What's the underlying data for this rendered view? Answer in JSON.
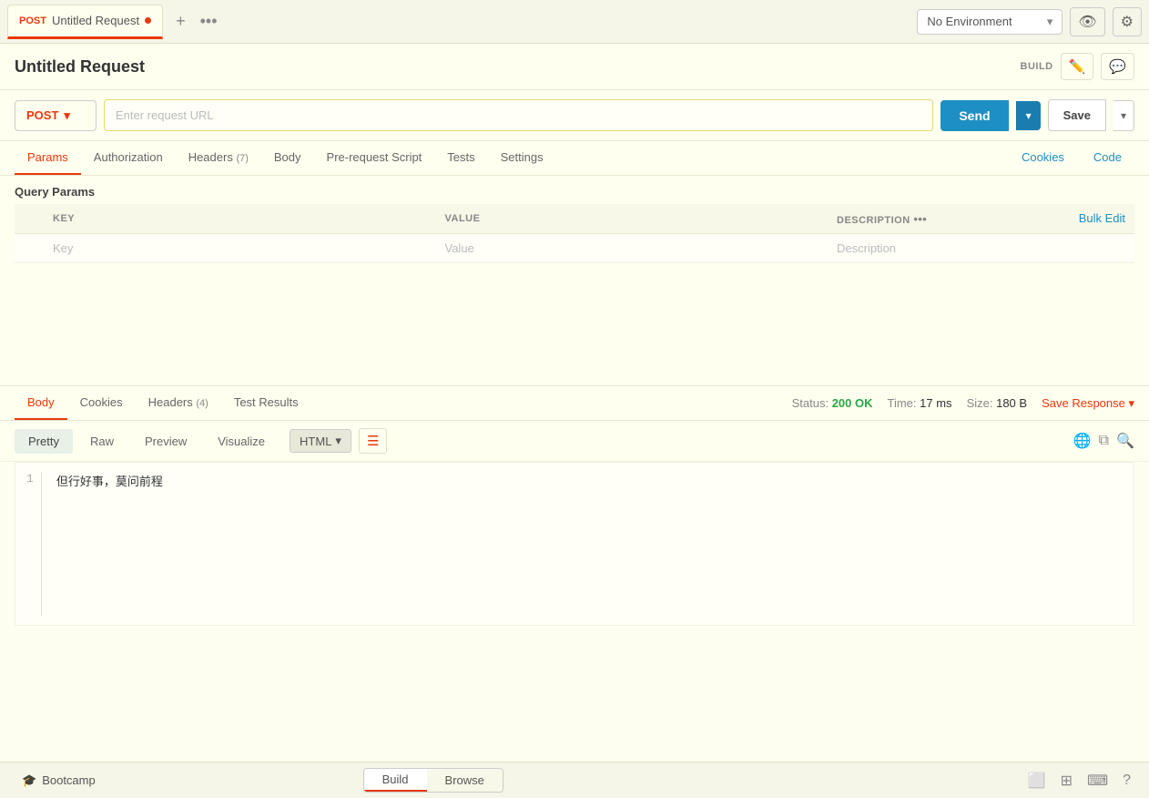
{
  "tab": {
    "method": "POST",
    "name": "Untitled Request",
    "dot": true
  },
  "header": {
    "title": "Untitled Request",
    "build_label": "BUILD"
  },
  "url": {
    "method": "POST",
    "placeholder": "Enter request URL",
    "send_label": "Send",
    "save_label": "Save"
  },
  "request_tabs": [
    {
      "label": "Params",
      "active": true
    },
    {
      "label": "Authorization",
      "active": false
    },
    {
      "label": "Headers (7)",
      "active": false
    },
    {
      "label": "Body",
      "active": false
    },
    {
      "label": "Pre-request Script",
      "active": false
    },
    {
      "label": "Tests",
      "active": false
    },
    {
      "label": "Settings",
      "active": false
    }
  ],
  "request_tab_right": [
    {
      "label": "Cookies"
    },
    {
      "label": "Code"
    }
  ],
  "params": {
    "section_label": "Query Params",
    "columns": [
      {
        "key": "KEY"
      },
      {
        "key": "VALUE"
      },
      {
        "key": "DESCRIPTION"
      }
    ],
    "placeholder_row": {
      "key": "Key",
      "value": "Value",
      "description": "Description"
    },
    "bulk_edit_label": "Bulk Edit"
  },
  "response_tabs": [
    {
      "label": "Body",
      "active": true
    },
    {
      "label": "Cookies",
      "active": false
    },
    {
      "label": "Headers (4)",
      "active": false
    },
    {
      "label": "Test Results",
      "active": false
    }
  ],
  "response_status": {
    "status_label": "Status:",
    "status_value": "200 OK",
    "time_label": "Time:",
    "time_value": "17 ms",
    "size_label": "Size:",
    "size_value": "180 B",
    "save_response_label": "Save Response"
  },
  "format_tabs": [
    {
      "label": "Pretty",
      "active": true
    },
    {
      "label": "Raw",
      "active": false
    },
    {
      "label": "Preview",
      "active": false
    },
    {
      "label": "Visualize",
      "active": false
    }
  ],
  "format_select": {
    "value": "HTML"
  },
  "response_content": {
    "line": 1,
    "text": "但行好事，莫问前程"
  },
  "bottom": {
    "bootcamp_label": "Bootcamp",
    "build_label": "Build",
    "browse_label": "Browse"
  },
  "env": {
    "label": "No Environment"
  }
}
